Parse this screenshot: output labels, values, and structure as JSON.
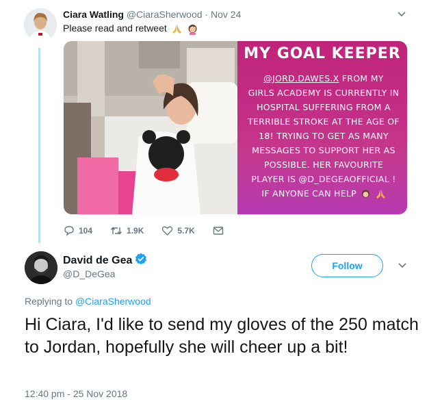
{
  "tweet1": {
    "author_name": "Ciara Watling",
    "author_handle": "@CiaraSherwood",
    "separator": " · ",
    "date": "Nov 24",
    "text": "Please read and retweet",
    "emojis": [
      "pray-emoji",
      "woman-facepalm-emoji"
    ],
    "media": {
      "promo_title": "MY GOAL KEEPER",
      "promo_handle": "@JORD.DAWES.X",
      "promo_lines": [
        "FROM MY",
        "GIRLS ACADEMY IS CURRENTLY IN",
        "HOSPITAL SUFFERING FROM A",
        "TERRIBLE STROKE AT THE AGE OF",
        "18! TRYING TO GET AS MANY",
        "MESSAGES TO SUPPORT HER AS",
        "POSSIBLE. HER FAVOURITE",
        "PLAYER IS @D_DEGEAOFFICIAL !",
        "IF ANYONE CAN HELP"
      ]
    },
    "actions": {
      "replies": "104",
      "retweets": "1.9K",
      "likes": "5.7K"
    }
  },
  "tweet2": {
    "author_name": "David de Gea",
    "author_handle": "@D_DeGea",
    "follow_label": "Follow",
    "replying_prefix": "Replying to ",
    "replying_handle": "@CiaraSherwood",
    "text": "Hi Ciara, I'd like to send my gloves of the 250 match to Jordan, hopefully she will cheer up a bit!",
    "timestamp": "12:40 pm - 25 Nov 2018"
  },
  "colors": {
    "accent": "#1da1f2",
    "muted": "#657786",
    "text": "#14171a",
    "thread_line": "#b8e0f5",
    "promo_pink": "#c22a82"
  }
}
